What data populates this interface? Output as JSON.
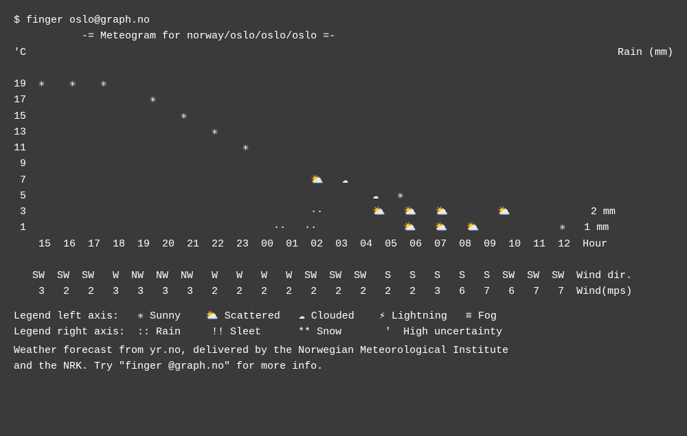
{
  "terminal": {
    "command": "$ finger oslo@graph.no",
    "title": "           -= Meteogram for norway/oslo/oslo/oslo =-",
    "y_axis_label": "'C",
    "rain_label": "Rain (mm)",
    "chart_lines": [
      "19  *    *    *",
      "17                    *",
      "15                         *",
      "13                              *",
      "11                                   *",
      "9",
      "7                                              ☁̈   ☁",
      "5                                                        ☁",
      "3                                                   ::        ☁̈   ☁̈   ☁̈        ☁̈             2 mm",
      "1                                             ::   ::              ☁̈   ☁̈   ☁̈             ☁̈   1 mm",
      "   15  16  17  18  19  20  21  22  23  00  01  02  03  04  05  06  07  08  09  10  11  12  Hour"
    ],
    "wind_dir_row": "   SW  SW  SW   W  NW  NW  NW   W   W   W   W  SW  SW  SW   S   S   S   S   S  SW  SW  SW  Wind dir.",
    "wind_spd_row": "    3   2   2   3   3   3   3   2   2   2   2   2   2   2   2   2   3   6   7   6   7   7  Wind(mps)",
    "legend1": "Legend left axis:   * Sunny    ☁̈ Scattered   ☁ Clouded    ⚡ Lightning   ≡ Fog",
    "legend2": "Legend right axis:  :: Rain     !! Sleet      ** Snow       '  High uncertainty",
    "footer1": "Weather forecast from yr.no, delivered by the Norwegian Meteorological Institute",
    "footer2": "and the NRK. Try \"finger @graph.no\" for more info."
  }
}
